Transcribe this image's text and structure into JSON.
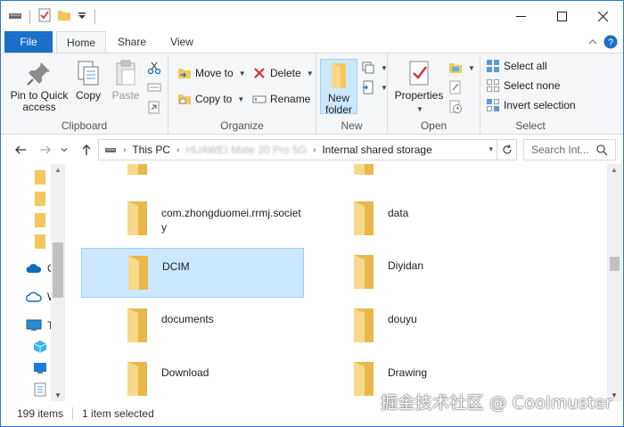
{
  "tabs": {
    "file": "File",
    "home": "Home",
    "share": "Share",
    "view": "View"
  },
  "ribbon": {
    "clipboard": {
      "label": "Clipboard",
      "pin_line1": "Pin to Quick",
      "pin_line2": "access",
      "copy": "Copy",
      "paste": "Paste"
    },
    "organize": {
      "label": "Organize",
      "move_to": "Move to",
      "copy_to": "Copy to",
      "delete": "Delete",
      "rename": "Rename"
    },
    "new": {
      "label": "New",
      "new_folder_line1": "New",
      "new_folder_line2": "folder"
    },
    "open": {
      "label": "Open",
      "properties": "Properties"
    },
    "select": {
      "label": "Select",
      "select_all": "Select all",
      "select_none": "Select none",
      "invert_selection": "Invert selection"
    }
  },
  "address": {
    "crumb_this_pc": "This PC",
    "crumb_device": "HUAWEI Mate 20 Pro 5G",
    "crumb_storage": "Internal shared storage"
  },
  "search": {
    "placeholder": "Search Int..."
  },
  "nav": {
    "onedrive_initial": "O",
    "network_initial": "W",
    "thispc_initial": "T"
  },
  "files": [
    {
      "name": "com.zhongduomei.rrmj.society"
    },
    {
      "name": "data"
    },
    {
      "name": "DCIM",
      "selected": true
    },
    {
      "name": "Diyidan"
    },
    {
      "name": "documents"
    },
    {
      "name": "douyu"
    },
    {
      "name": "Download"
    },
    {
      "name": "Drawing"
    }
  ],
  "status": {
    "count": "199 items",
    "selected": "1 item selected"
  },
  "watermark": "掘金技术社区 @ Coolmuster",
  "colors": {
    "accent": "#1a6fc8",
    "selection": "#cce8ff",
    "folder": "#f4c75d"
  }
}
